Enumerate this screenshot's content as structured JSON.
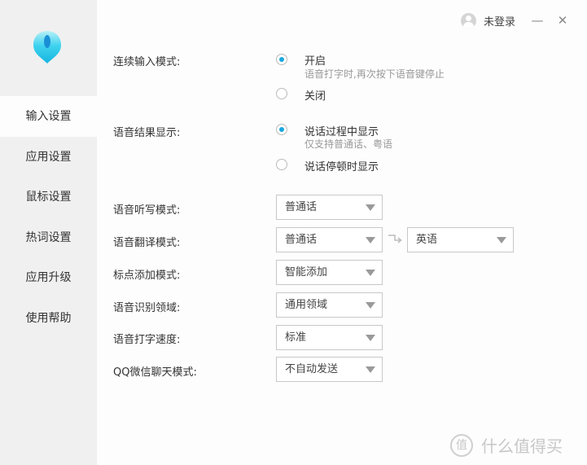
{
  "header": {
    "user_label": "未登录",
    "minimize_glyph": "—",
    "close_glyph": "✕"
  },
  "sidebar": {
    "logo": "app-logo",
    "items": [
      {
        "label": "输入设置",
        "active": true
      },
      {
        "label": "应用设置",
        "active": false
      },
      {
        "label": "鼠标设置",
        "active": false
      },
      {
        "label": "热词设置",
        "active": false
      },
      {
        "label": "应用升级",
        "active": false
      },
      {
        "label": "使用帮助",
        "active": false
      }
    ]
  },
  "settings": {
    "continuous_input": {
      "label": "连续输入模式:",
      "options": [
        {
          "label": "开启",
          "hint": "语音打字时,再次按下语音键停止",
          "checked": true
        },
        {
          "label": "关闭",
          "hint": "",
          "checked": false
        }
      ]
    },
    "result_display": {
      "label": "语音结果显示:",
      "options": [
        {
          "label": "说话过程中显示",
          "hint": "仅支持普通话、粤语",
          "checked": true
        },
        {
          "label": "说话停顿时显示",
          "hint": "",
          "checked": false
        }
      ]
    },
    "dictation_mode": {
      "label": "语音听写模式:",
      "value": "普通话"
    },
    "translation_mode": {
      "label": "语音翻译模式:",
      "from": "普通话",
      "to": "英语"
    },
    "punctuation_mode": {
      "label": "标点添加模式:",
      "value": "智能添加"
    },
    "recognition_domain": {
      "label": "语音识别领域:",
      "value": "通用领域"
    },
    "typing_speed": {
      "label": "语音打字速度:",
      "value": "标准"
    },
    "chat_mode": {
      "label": "QQ微信聊天模式:",
      "value": "不自动发送"
    }
  },
  "watermark": {
    "badge": "值",
    "text": "什么值得买"
  },
  "colors": {
    "accent": "#1aa7e0",
    "sidebar_bg": "#f0f0f0"
  }
}
